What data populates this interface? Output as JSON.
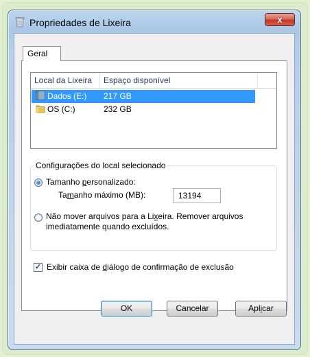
{
  "window": {
    "title": "Propriedades de Lixeira",
    "close_glyph": "x"
  },
  "tabs": [
    {
      "label": "Geral"
    }
  ],
  "list": {
    "headers": {
      "location": "Local da Lixeira",
      "space": "Espaço disponível"
    },
    "rows": [
      {
        "name": "Dados (E:)",
        "space": "217 GB",
        "selected": true,
        "icon": "drive-icon"
      },
      {
        "name": "OS (C:)",
        "space": "232 GB",
        "selected": false,
        "icon": "folder-icon"
      }
    ]
  },
  "settings_group": {
    "title": "Configurações do local selecionado",
    "custom_size": {
      "pre": "Tamanho ",
      "ul": "p",
      "post": "ersonalizado:",
      "checked": true
    },
    "max_size": {
      "pre": "Ta",
      "ul": "m",
      "post": "anho máximo (MB):",
      "value": "13194"
    },
    "no_move": {
      "line1_pre": "Não mover arquivos para a Li",
      "line1_ul": "x",
      "line1_post": "eira. Remover arquivos",
      "line2": "imediatamente quando excluídos.",
      "checked": false
    }
  },
  "confirm_checkbox": {
    "pre": "Exibir caixa de ",
    "ul": "d",
    "post": "iálogo de confirmação de exclusão",
    "checked": true,
    "check_glyph": "✓"
  },
  "buttons": {
    "ok": "OK",
    "cancel": "Cancelar",
    "apply_pre": "Apl",
    "apply_ul": "i",
    "apply_post": "car"
  },
  "colors": {
    "selection": "#3399ff",
    "close_button": "#c1382a",
    "outer_background": "#e4f0d4"
  }
}
